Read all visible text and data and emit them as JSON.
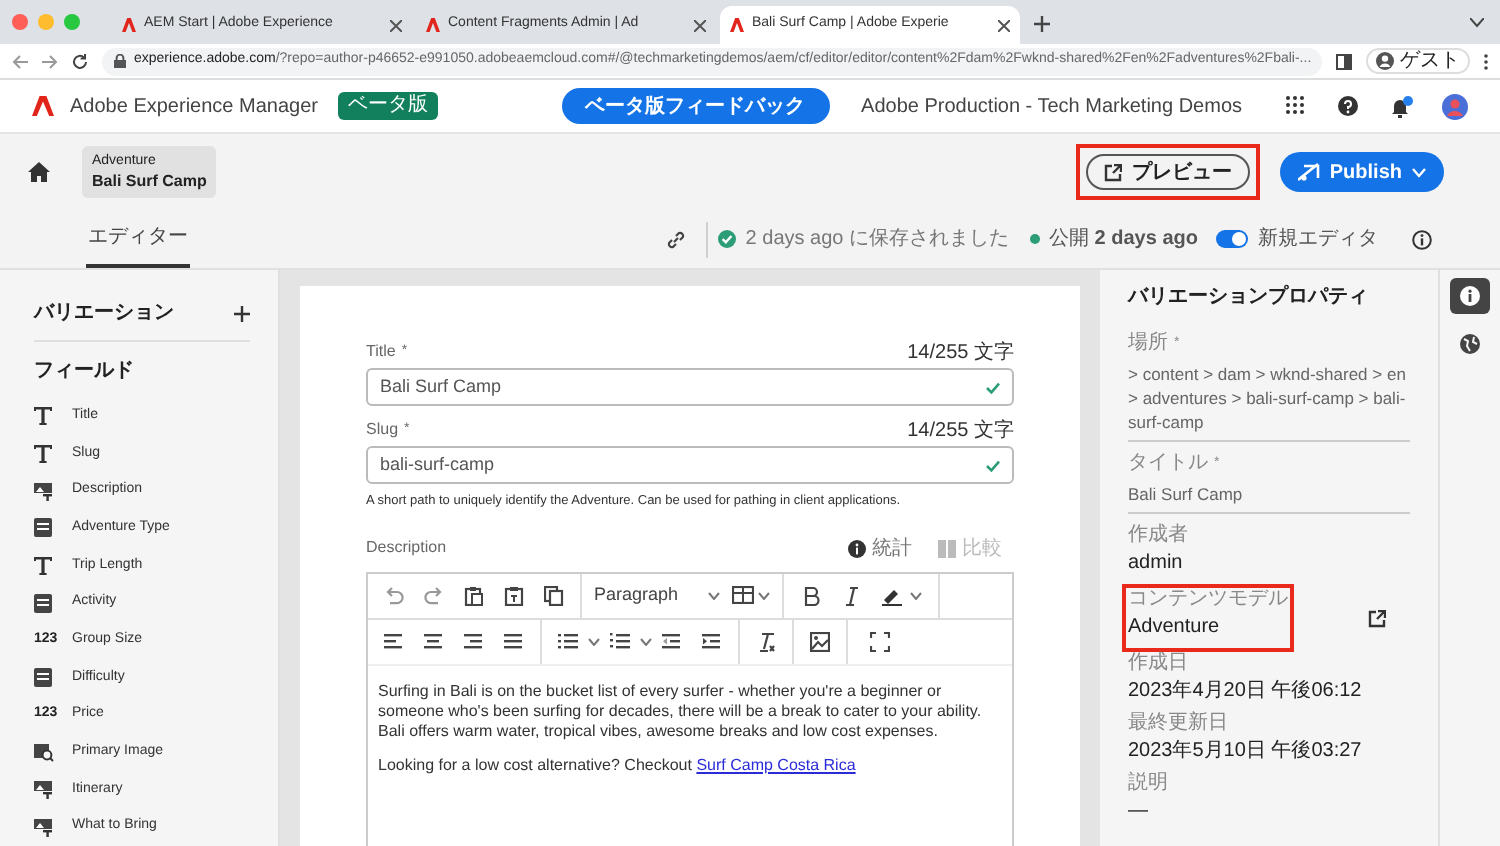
{
  "browser": {
    "tabs": [
      {
        "title": "AEM Start | Adobe Experience",
        "selected": false
      },
      {
        "title": "Content Fragments Admin | Ad",
        "selected": false
      },
      {
        "title": "Bali Surf Camp | Adobe Experie",
        "selected": true
      }
    ],
    "url_host": "experience.adobe.com",
    "url_path": "/?repo=author-p46652-e991050.adobeaemcloud.com#/@techmarketingdemos/aem/cf/editor/editor/content%2Fdam%2Fwknd-shared%2Fen%2Fadventures%2Fbali-...",
    "profile": "ゲスト"
  },
  "header": {
    "product": "Adobe Experience Manager",
    "beta_badge": "ベータ版",
    "feedback_button": "ベータ版フィードバック",
    "org": "Adobe Production - Tech Marketing Demos",
    "notification": true
  },
  "breadcrumb": {
    "type": "Adventure",
    "title": "Bali Surf Camp"
  },
  "actions": {
    "preview": {
      "label": "プレビュー",
      "highlighted": true
    },
    "publish": "Publish"
  },
  "tabs": [
    {
      "label": "エディター",
      "selected": true
    }
  ],
  "status": {
    "saved": "2 days ago に保存されました",
    "published": "公開 **2 days ago**",
    "new_editor": {
      "label": "新規エディタ",
      "on": true
    }
  },
  "sidebar": {
    "variations": "バリエーション",
    "fields_heading": "フィールド",
    "fields": [
      {
        "label": "Title",
        "kind": "text"
      },
      {
        "label": "Slug",
        "kind": "text"
      },
      {
        "label": "Description",
        "kind": "richtext"
      },
      {
        "label": "Adventure Type",
        "kind": "enum"
      },
      {
        "label": "Trip Length",
        "kind": "text"
      },
      {
        "label": "Activity",
        "kind": "enum"
      },
      {
        "label": "Group Size",
        "kind": "number",
        "icon": "123"
      },
      {
        "label": "Difficulty",
        "kind": "enum"
      },
      {
        "label": "Price",
        "kind": "number",
        "icon": "123"
      },
      {
        "label": "Primary Image",
        "kind": "image"
      },
      {
        "label": "Itinerary",
        "kind": "richtext"
      },
      {
        "label": "What to Bring",
        "kind": "richtext"
      }
    ]
  },
  "form": {
    "fields": [
      {
        "label": "Title",
        "required_mark": "*",
        "counter": "14/255 文字",
        "value": "Bali Surf Camp",
        "valid": true
      },
      {
        "label": "Slug",
        "required_mark": "*",
        "counter": "14/255 文字",
        "value": "bali-surf-camp",
        "valid": true,
        "hint": "A short path to uniquely identify the Adventure. Can be used for pathing in client applications."
      }
    ],
    "description": {
      "label": "Description",
      "stats": "統計",
      "compare": "比較",
      "format": "Paragraph",
      "paragraphs": [
        {
          "text": "Surfing in Bali is on the bucket list of every surfer - whether you're a beginner or someone who's been surfing for decades, there will be a break to cater to your ability. Bali offers warm water, tropical vibes, awesome breaks and low cost expenses."
        },
        {
          "text": "Looking for a low cost alternative? Checkout ",
          "link": "Surf Camp Costa Rica"
        }
      ]
    }
  },
  "properties": {
    "heading": "バリエーションプロパティ",
    "items": [
      {
        "label": "場所",
        "required_mark": "*",
        "value": " > content > dam > wknd-shared > en > adventures > bali-surf-camp > bali-surf-camp",
        "kind": "field",
        "highlighted": false
      },
      {
        "label": "タイトル",
        "required_mark": "*",
        "value": "Bali Surf Camp",
        "kind": "field",
        "highlighted": false
      },
      {
        "label": "作成者",
        "value": "admin",
        "kind": "info",
        "highlighted": false
      },
      {
        "label": "コンテンツモデル",
        "value": "Adventure",
        "kind": "info",
        "highlighted": true,
        "link": true
      },
      {
        "label": "作成日",
        "value": "2023年4月20日 午後06:12",
        "kind": "info",
        "highlighted": false
      },
      {
        "label": "最終更新日",
        "value": "2023年5月10日 午後03:27",
        "kind": "info",
        "highlighted": false
      },
      {
        "label": "説明",
        "value": "—",
        "kind": "info",
        "highlighted": false
      }
    ]
  },
  "rail": [
    {
      "kind": "info",
      "selected": true
    },
    {
      "kind": "globe",
      "selected": false
    }
  ]
}
